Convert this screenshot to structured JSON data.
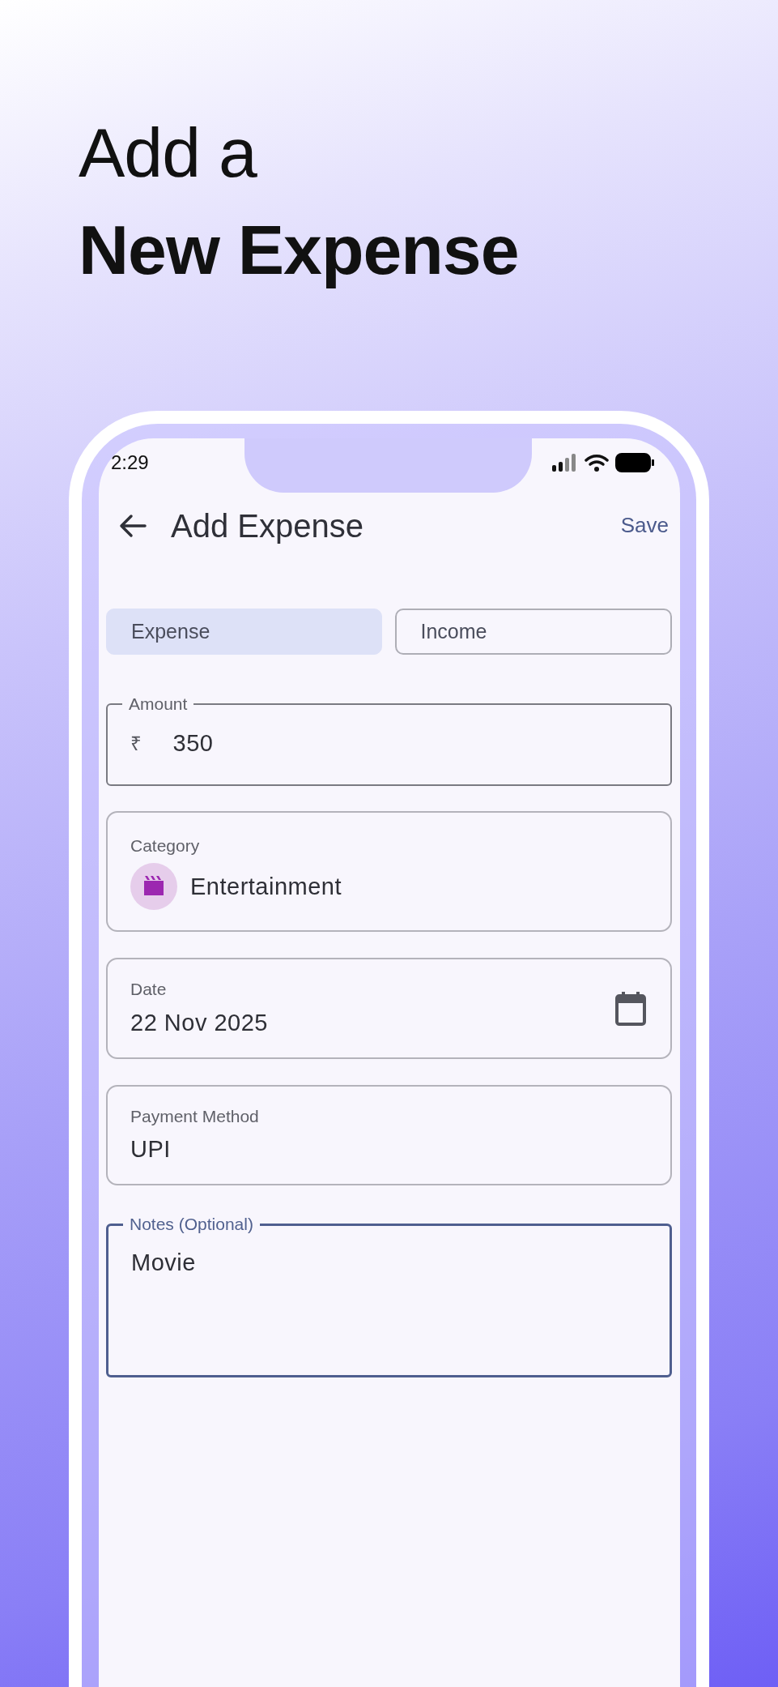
{
  "headline": {
    "line_1": "Add a",
    "line_2": "New Expense"
  },
  "status_bar": {
    "time": "2:29"
  },
  "app_bar": {
    "title": "Add Expense",
    "action": "Save"
  },
  "type_toggle": [
    {
      "label": "Expense",
      "selected": true
    },
    {
      "label": "Income",
      "selected": false
    }
  ],
  "fields": [
    {
      "kind": "outlined",
      "label": "Amount",
      "prefix": "₹",
      "value": "350",
      "focused": false
    },
    {
      "kind": "category",
      "label": "Category",
      "value": "Entertainment"
    },
    {
      "kind": "date",
      "label": "Date",
      "value": "22 Nov 2025"
    },
    {
      "kind": "plain",
      "label": "Payment Method",
      "value": "UPI"
    },
    {
      "kind": "notes",
      "label": "Notes (Optional)",
      "value": "Movie",
      "focused": true
    }
  ]
}
